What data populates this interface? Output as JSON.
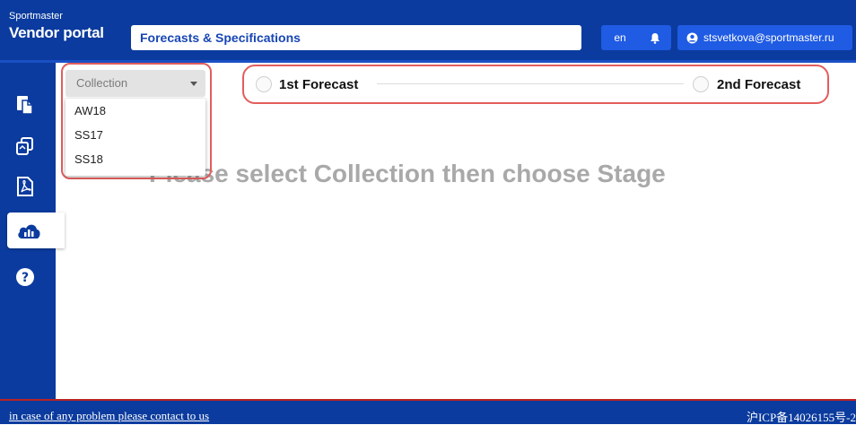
{
  "header": {
    "brand_small": "Sportmaster",
    "brand_big": "Vendor portal",
    "title": "Forecasts & Specifications",
    "lang": "en",
    "user_email": "stsvetkova@sportmaster.ru"
  },
  "sidebar": {
    "items": [
      {
        "icon": "documents-icon"
      },
      {
        "icon": "copy-icon"
      },
      {
        "icon": "pdf-icon"
      },
      {
        "icon": "cloud-chart-icon",
        "active": true
      },
      {
        "icon": "help-icon"
      }
    ],
    "expand_label": "»"
  },
  "collection": {
    "placeholder": "Collection",
    "options": [
      "AW18",
      "SS17",
      "SS18"
    ]
  },
  "stages": {
    "first": "1st Forecast",
    "second": "2nd Forecast"
  },
  "message": "Please select Collection then choose Stage",
  "footer": {
    "link": "in case of any problem please contact to us",
    "icp": "沪ICP备14026155号-2"
  },
  "colors": {
    "primary": "#0b3b9e",
    "accent": "#1f5be3",
    "highlight_border": "#e35d5d"
  }
}
